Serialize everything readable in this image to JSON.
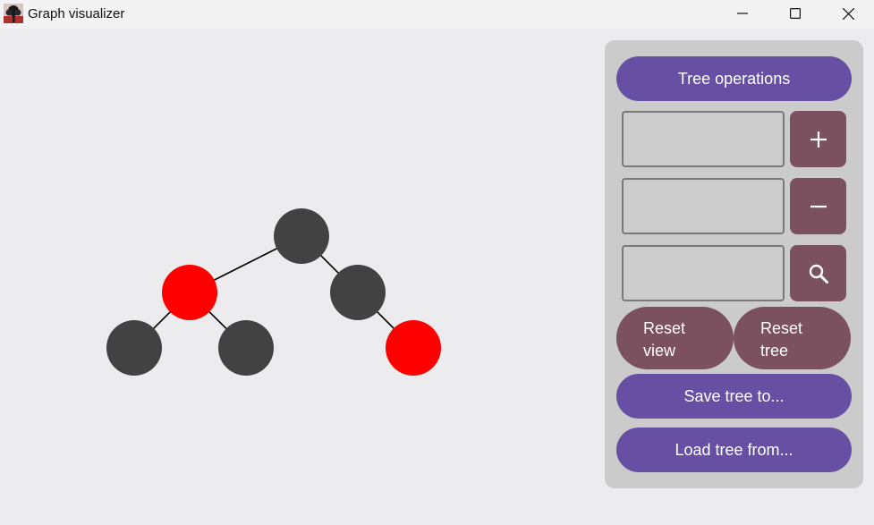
{
  "window": {
    "title": "Graph visualizer",
    "icons": {
      "app": "tree-icon",
      "minimize": "minimize-icon",
      "maximize": "maximize-icon",
      "close": "close-icon"
    }
  },
  "panel": {
    "tree_operations_label": "Tree operations",
    "insert": {
      "value": "",
      "icon": "plus-icon"
    },
    "remove": {
      "value": "",
      "icon": "minus-icon"
    },
    "search": {
      "value": "",
      "icon": "search-icon"
    },
    "reset_view": {
      "line1": "Reset",
      "line2": "view"
    },
    "reset_tree": {
      "line1": "Reset",
      "line2": "tree"
    },
    "save_label": "Save tree to...",
    "load_label": "Load tree from..."
  },
  "tree": {
    "nodes": [
      {
        "id": "root",
        "color": "black"
      },
      {
        "id": "left",
        "color": "red"
      },
      {
        "id": "right",
        "color": "black"
      },
      {
        "id": "left-left",
        "color": "black"
      },
      {
        "id": "left-right",
        "color": "black"
      },
      {
        "id": "right-right",
        "color": "red"
      }
    ],
    "edges": [
      [
        "root",
        "left"
      ],
      [
        "root",
        "right"
      ],
      [
        "left",
        "left-left"
      ],
      [
        "left",
        "left-right"
      ],
      [
        "right",
        "right-right"
      ]
    ],
    "colors": {
      "black": "#424242",
      "red": "#ff0000"
    }
  },
  "colors": {
    "primary": "#6750a4",
    "secondary": "#7b515f",
    "panel": "#cbcbcb",
    "background": "#ececee"
  }
}
